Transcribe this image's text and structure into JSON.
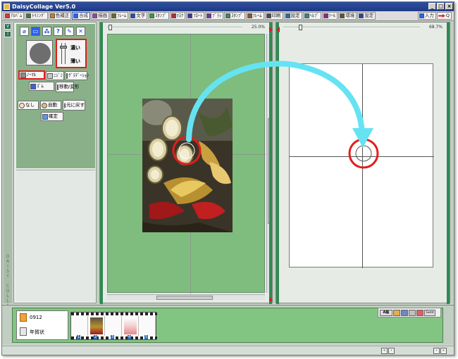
{
  "window": {
    "title": "DaisyCollage Ver5.0",
    "min_glyph": "_",
    "max_glyph": "□",
    "close_glyph": "×"
  },
  "toolbar": {
    "items": [
      {
        "label": "ｱﾙﾊﾞﾑ",
        "icon": "album-icon",
        "color": "#d23a3a"
      },
      {
        "label": "ﾄﾘﾐﾝｸﾞ",
        "icon": "trimming-icon",
        "color": "#3a7d3a"
      },
      {
        "label": "色補正",
        "icon": "color-correct-icon",
        "color": "#d67a1a"
      },
      {
        "label": "合成",
        "icon": "composite-icon",
        "color": "#2a62e8",
        "active": true
      },
      {
        "label": "描画",
        "icon": "draw-icon",
        "color": "#a040a0"
      },
      {
        "label": "ﾌﾚｰﾑ",
        "icon": "frame-icon",
        "color": "#6a6a2a"
      },
      {
        "label": "文字",
        "icon": "text-icon",
        "color": "#1a4cc7"
      },
      {
        "label": "ｽﾀﾝﾌﾟ",
        "icon": "stamp-icon",
        "color": "#3a9a3a"
      },
      {
        "label": "ﾏｽｸ",
        "icon": "mask-icon",
        "color": "#b03030"
      },
      {
        "label": "ﾌﾛｰﾄ",
        "icon": "float-icon",
        "color": "#3a3a9a"
      },
      {
        "label": "ﾌﾞﾗｼ",
        "icon": "brush-icon",
        "color": "#6a3a9a"
      },
      {
        "label": "ｽﾀﾝﾌﾟ",
        "icon": "stamp2-icon",
        "color": "#3a8a5a"
      },
      {
        "label": "ﾌﾚｰﾑ",
        "icon": "frame2-icon",
        "color": "#8a5a2a"
      },
      {
        "label": "印刷",
        "icon": "print-icon",
        "color": "#4a4a4a"
      },
      {
        "label": "設定",
        "icon": "settings-icon",
        "color": "#2a6ab0"
      },
      {
        "label": "ﾍﾙﾌﾟ",
        "icon": "help-icon",
        "color": "#2a8a8a"
      },
      {
        "label": "ﾂｰﾙ",
        "icon": "tool-icon",
        "color": "#8a2a8a"
      },
      {
        "label": "環境",
        "icon": "env-icon",
        "color": "#5a5a2a"
      },
      {
        "label": "設定",
        "icon": "config-icon",
        "color": "#2a4a8a"
      }
    ],
    "input_label": "入力",
    "output_label": "Q"
  },
  "left_strip": {
    "btn_a": "V",
    "btn_b": "Ξ",
    "vertical_text": "DAISY COLLAGE"
  },
  "tool_panel": {
    "top_icons": [
      {
        "glyph": "⌀",
        "name": "brush-mode-icon"
      },
      {
        "glyph": "▭",
        "name": "rect-select-icon"
      },
      {
        "glyph": "⁂",
        "name": "tree-icon"
      },
      {
        "glyph": "?",
        "name": "question-icon"
      },
      {
        "glyph": "✎",
        "name": "pen-icon"
      },
      {
        "glyph": "✕",
        "name": "cancel-icon"
      }
    ],
    "density_high": "濃い",
    "density_low": "薄い",
    "btn_normal": "ﾉｰﾏﾙ",
    "btn_smudge": "ﾆｼﾞﾐ",
    "btn_gradient": "ｸﾞﾗﾃﾞｰｼｮﾝ",
    "btn_eraser": "ｺﾞﾑ",
    "btn_transform": "移動/変形",
    "btn_none": "なし",
    "btn_auto": "自動",
    "btn_reset": "元に戻す",
    "btn_confirm": "確定"
  },
  "left_pane": {
    "zoom_label": "25.0%"
  },
  "right_pane": {
    "zoom_label": "68.7%"
  },
  "bottom": {
    "file_name": "0912",
    "file_desc": "年賀状",
    "frame_numbers": [
      "1",
      "2",
      "3",
      "4",
      "5"
    ],
    "tool_text": "A",
    "tool_text2": "般",
    "tool_wide": "Getit"
  },
  "colors": {
    "accent_blue": "#2a62e8",
    "highlight_red": "#e21d1d",
    "arrow_cyan": "#66e3f2",
    "canvas_green": "#7ebd7e"
  }
}
